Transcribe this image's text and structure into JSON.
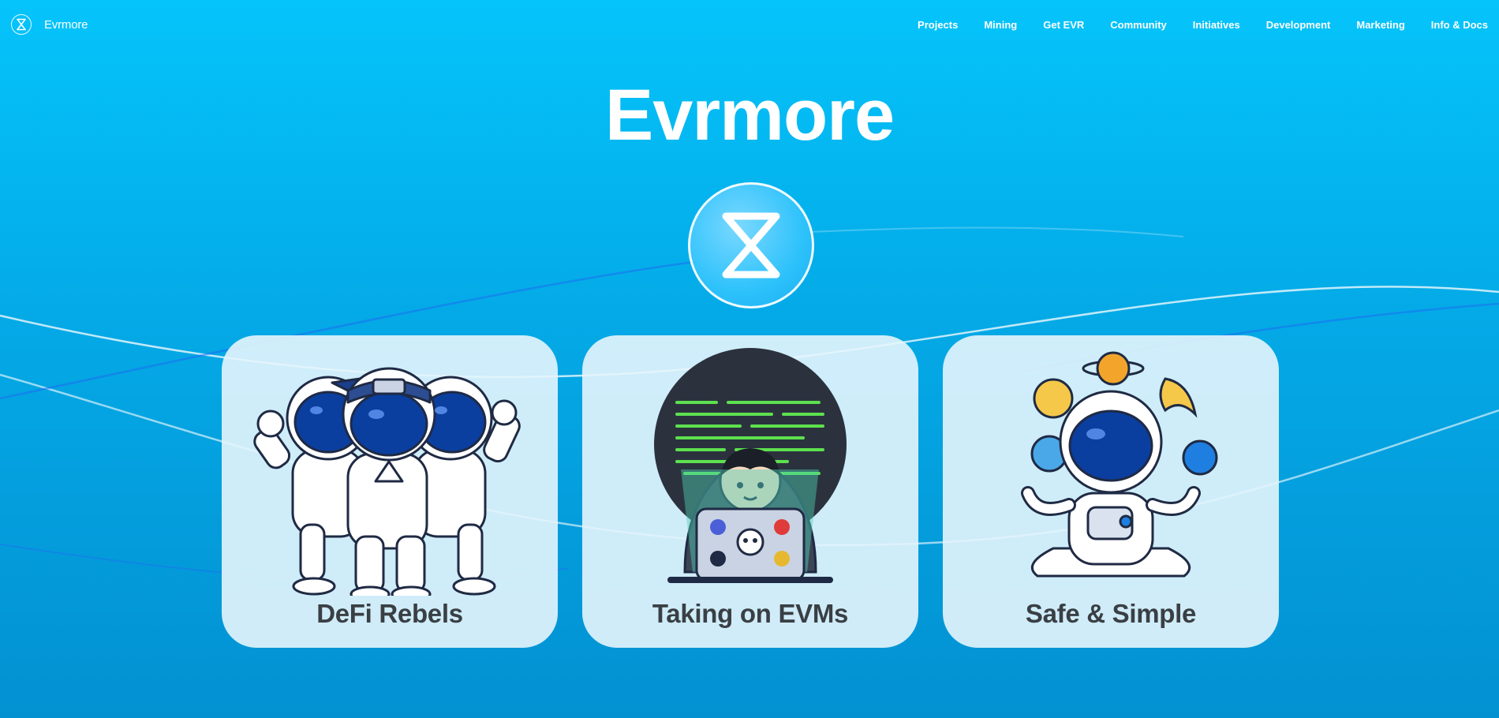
{
  "brand": {
    "name": "Evrmore",
    "icon": "hourglass-icon"
  },
  "nav": {
    "links": [
      "Projects",
      "Mining",
      "Get EVR",
      "Community",
      "Initiatives",
      "Development",
      "Marketing",
      "Info & Docs"
    ]
  },
  "hero": {
    "title": "Evrmore",
    "logo_icon": "hourglass-icon"
  },
  "cards": [
    {
      "title": "DeFi Rebels",
      "illustration": "astronaut-group-illustration"
    },
    {
      "title": "Taking on EVMs",
      "illustration": "hacker-laptop-illustration"
    },
    {
      "title": "Safe & Simple",
      "illustration": "meditating-astronaut-illustration"
    }
  ],
  "colors": {
    "background_top": "#05c4fb",
    "background_bottom": "#0391d2",
    "card": "#e6f5fc",
    "card_text": "#3a3f44",
    "astronaut_visor": "#0a3fa0"
  }
}
